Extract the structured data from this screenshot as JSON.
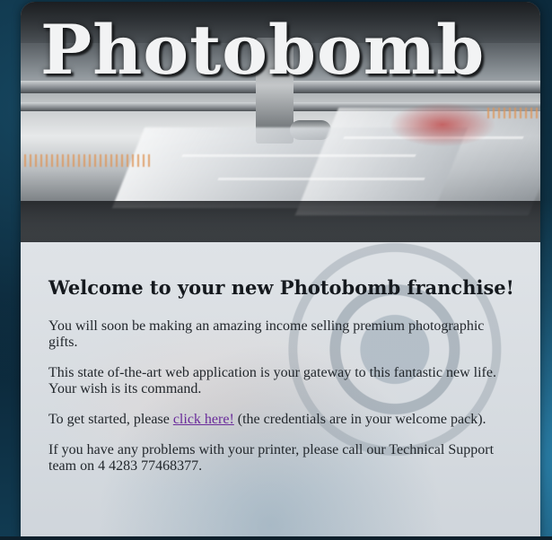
{
  "site": {
    "title": "Photobomb"
  },
  "welcome": {
    "heading": "Welcome to your new Photobomb franchise!",
    "para1": "You will soon be making an amazing income selling premium photographic gifts.",
    "para2": "This state of-the-art web application is your gateway to this fantastic new life. Your wish is its command.",
    "para3_before": "To get started, please ",
    "para3_link": "click here!",
    "para3_after": " (the credentials are in your welcome pack).",
    "para4": "If you have any problems with your printer, please call our Technical Support team on 4 4283 77468377."
  },
  "colors": {
    "link": "#6a2b9a",
    "page_background": "#0c2a3c",
    "content_background": "#d9dee4",
    "title_text": "#f2f3f4"
  }
}
